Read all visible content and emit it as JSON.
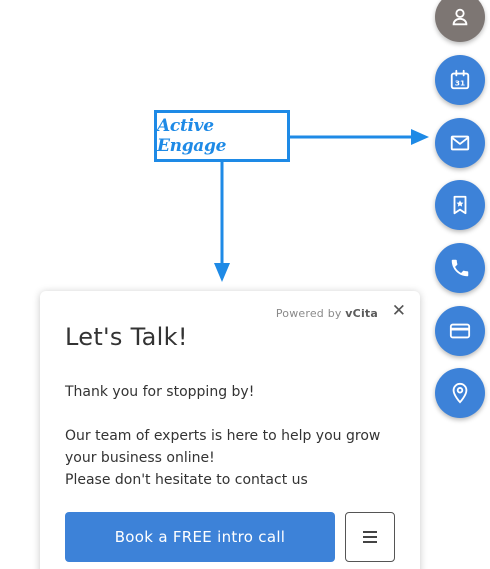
{
  "annotation": {
    "label": "Active Engage",
    "color": "#1e8ae6"
  },
  "side_actions": [
    {
      "icon": "user-icon",
      "color": "#7d7673"
    },
    {
      "icon": "calendar-icon",
      "color": "#3d82d8",
      "calendar_day": "31"
    },
    {
      "icon": "envelope-icon",
      "color": "#3d82d8"
    },
    {
      "icon": "bookmark-icon",
      "color": "#3d82d8"
    },
    {
      "icon": "phone-icon",
      "color": "#3d82d8"
    },
    {
      "icon": "credit-card-icon",
      "color": "#3d82d8"
    },
    {
      "icon": "location-pin-icon",
      "color": "#3d82d8"
    }
  ],
  "widget": {
    "powered_prefix": "Powered by",
    "powered_brand": "vCita",
    "close_glyph": "✕",
    "title": "Let's Talk!",
    "greeting": "Thank you for stopping by!",
    "body_line_1": "Our team of experts is here to help you grow",
    "body_line_2": "your business online!",
    "body_line_3": "Please don't hesitate to contact us",
    "cta_label": "Book a FREE intro call",
    "menu_icon": "hamburger-menu-icon",
    "accent_color": "#3d82d8"
  }
}
